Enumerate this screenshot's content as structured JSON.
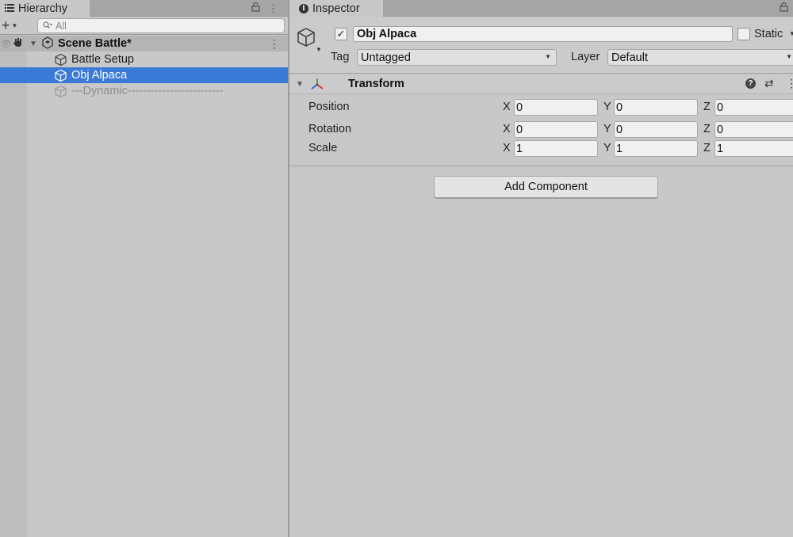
{
  "hierarchy": {
    "tab_label": "Hierarchy",
    "search": {
      "placeholder": "All"
    },
    "scene": {
      "label": "Scene Battle*"
    },
    "items": [
      {
        "label": "Battle Setup",
        "state": "normal"
      },
      {
        "label": "Obj Alpaca",
        "state": "selected"
      },
      {
        "label": "---Dynamic-------------------------",
        "state": "disabled"
      }
    ]
  },
  "inspector": {
    "tab_label": "Inspector",
    "object": {
      "name": "Obj Alpaca",
      "active": true,
      "static_label": "Static",
      "static_checked": false
    },
    "tag": {
      "label": "Tag",
      "value": "Untagged"
    },
    "layer": {
      "label": "Layer",
      "value": "Default"
    },
    "transform": {
      "title": "Transform",
      "rows": [
        {
          "label": "Position",
          "x": "0",
          "y": "0",
          "z": "0"
        },
        {
          "label": "Rotation",
          "x": "0",
          "y": "0",
          "z": "0"
        },
        {
          "label": "Scale",
          "x": "1",
          "y": "1",
          "z": "1"
        }
      ],
      "axis_labels": {
        "x": "X",
        "y": "Y",
        "z": "Z"
      }
    },
    "add_component_label": "Add Component"
  },
  "icons": {
    "hierarchy_tab": "list-icon",
    "inspector_tab": "info-icon",
    "lock": "lock-icon",
    "menu": "kebab-menu-icon",
    "gameobject": "cube-icon",
    "transform": "transform-axes-icon",
    "help": "help-icon",
    "presets": "preset-sliders-icon"
  },
  "colors": {
    "selection": "#3a79d6",
    "panel_bg": "#c8c8c8",
    "tab_bar": "#a5a5a5"
  }
}
